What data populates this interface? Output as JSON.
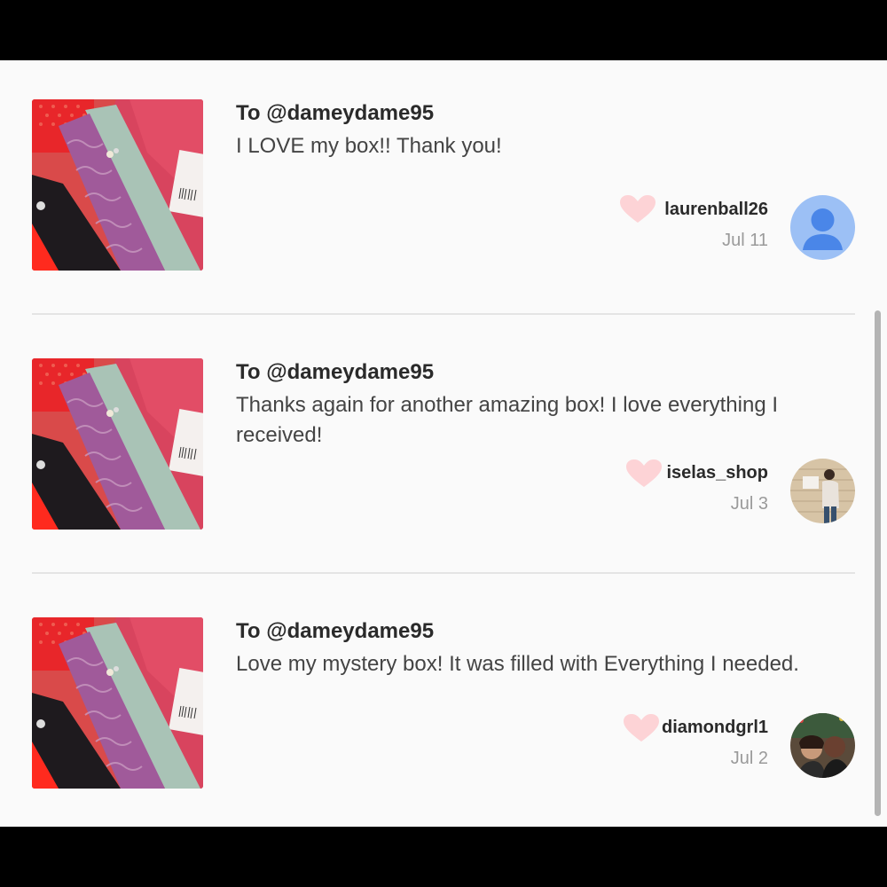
{
  "reviews": [
    {
      "to": "To @dameydame95",
      "message": "I LOVE my box!! Thank you!",
      "username": "laurenball26",
      "date": "Jul 11",
      "avatar": "default-person-avatar"
    },
    {
      "to": "To @dameydame95",
      "message": "Thanks again for another amazing box! I love everything I received!",
      "username": "iselas_shop",
      "date": "Jul 3",
      "avatar": "photo-avatar"
    },
    {
      "to": "To @dameydame95",
      "message": "Love my mystery box! It was filled with Everything I needed.",
      "username": "diamondgrl1",
      "date": "Jul 2",
      "avatar": "photo-avatar"
    }
  ],
  "colors": {
    "heart": "#fdd3d6",
    "default_avatar_bg": "#9cc0f5",
    "default_avatar_fg": "#4a86e8"
  }
}
